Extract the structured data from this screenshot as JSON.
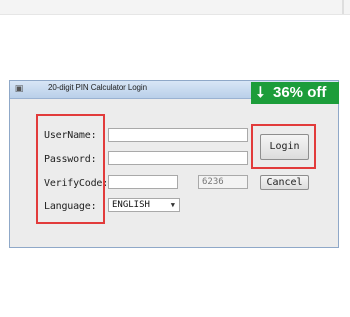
{
  "window": {
    "title": "20-digit PIN Calculator Login"
  },
  "promo": {
    "discount": "36% off",
    "icon": "down-arrow-icon",
    "color": "#1c9d3a"
  },
  "form": {
    "username_label": "UserName:",
    "password_label": "Password:",
    "verifycode_label": "VerifyCode:",
    "language_label": "Language:",
    "username_value": "",
    "password_value": "",
    "verifycode_value": "",
    "captcha_value": "6236",
    "language_value": "ENGLISH"
  },
  "buttons": {
    "login": "Login",
    "cancel": "Cancel"
  },
  "highlight_color": "#e23b3b"
}
